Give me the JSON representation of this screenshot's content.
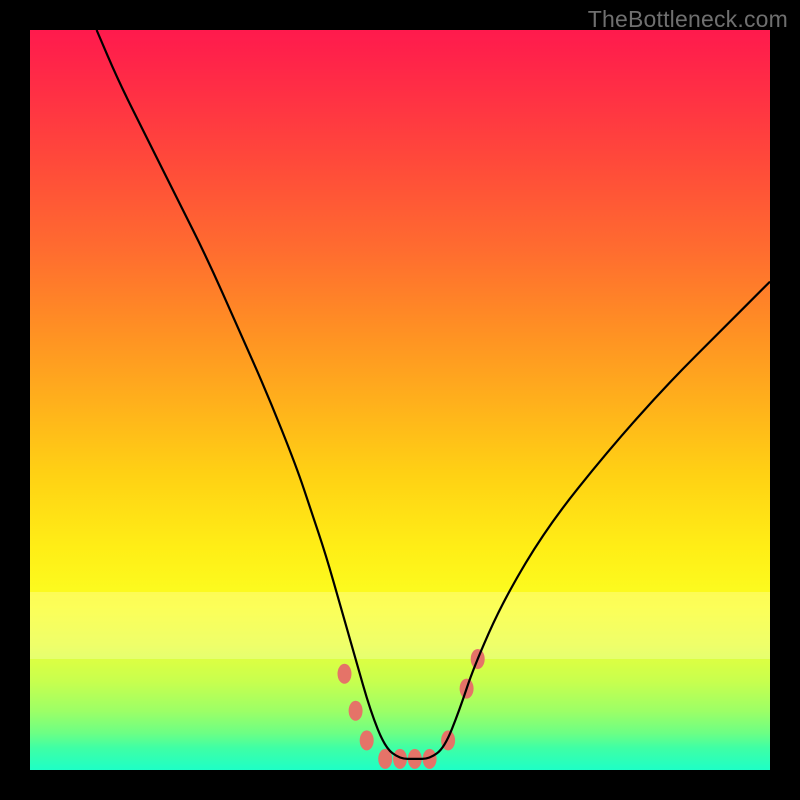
{
  "watermark": "TheBottleneck.com",
  "chart_data": {
    "type": "line",
    "title": "",
    "xlabel": "",
    "ylabel": "",
    "xlim": [
      0,
      100
    ],
    "ylim": [
      0,
      100
    ],
    "series": [
      {
        "name": "bottleneck-curve",
        "x": [
          9,
          12,
          16,
          20,
          24,
          28,
          32,
          36,
          38,
          40,
          42,
          44,
          46,
          48,
          50,
          52,
          54,
          56,
          58,
          60,
          64,
          70,
          78,
          86,
          94,
          100
        ],
        "values": [
          100,
          93,
          85,
          77,
          69,
          60,
          51,
          41,
          35,
          29,
          22,
          15,
          8,
          3,
          1.5,
          1.5,
          1.5,
          3,
          8,
          14,
          23,
          33,
          43,
          52,
          60,
          66
        ]
      }
    ],
    "markers": [
      {
        "x": 42.5,
        "y": 13,
        "label": "mark-left-upper"
      },
      {
        "x": 44.0,
        "y": 8,
        "label": "mark-left-mid"
      },
      {
        "x": 45.5,
        "y": 4,
        "label": "mark-left-lower"
      },
      {
        "x": 48.0,
        "y": 1.5,
        "label": "mark-bottom-1"
      },
      {
        "x": 50.0,
        "y": 1.5,
        "label": "mark-bottom-2"
      },
      {
        "x": 52.0,
        "y": 1.5,
        "label": "mark-bottom-3"
      },
      {
        "x": 54.0,
        "y": 1.5,
        "label": "mark-bottom-4"
      },
      {
        "x": 56.5,
        "y": 4,
        "label": "mark-right-lower"
      },
      {
        "x": 59.0,
        "y": 11,
        "label": "mark-right-mid"
      },
      {
        "x": 60.5,
        "y": 15,
        "label": "mark-right-upper"
      }
    ],
    "marker_style": {
      "color": "#e57368",
      "rx": 7,
      "ry": 10
    },
    "curve_style": {
      "stroke": "#000000",
      "width": 2.2
    }
  }
}
